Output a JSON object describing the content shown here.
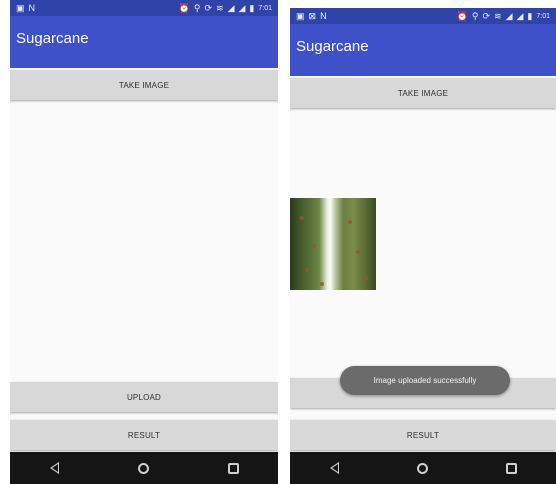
{
  "left": {
    "statusbar": {
      "time": "7:01"
    },
    "appbar": {
      "title": "Sugarcane"
    },
    "buttons": {
      "take_image": "TAKE IMAGE",
      "upload": "UPLOAD",
      "result": "RESULT"
    }
  },
  "right": {
    "statusbar": {
      "time": "7:01"
    },
    "appbar": {
      "title": "Sugarcane"
    },
    "buttons": {
      "take_image": "TAKE IMAGE",
      "result": "RESULT"
    },
    "toast": "Image uploaded successfully"
  }
}
